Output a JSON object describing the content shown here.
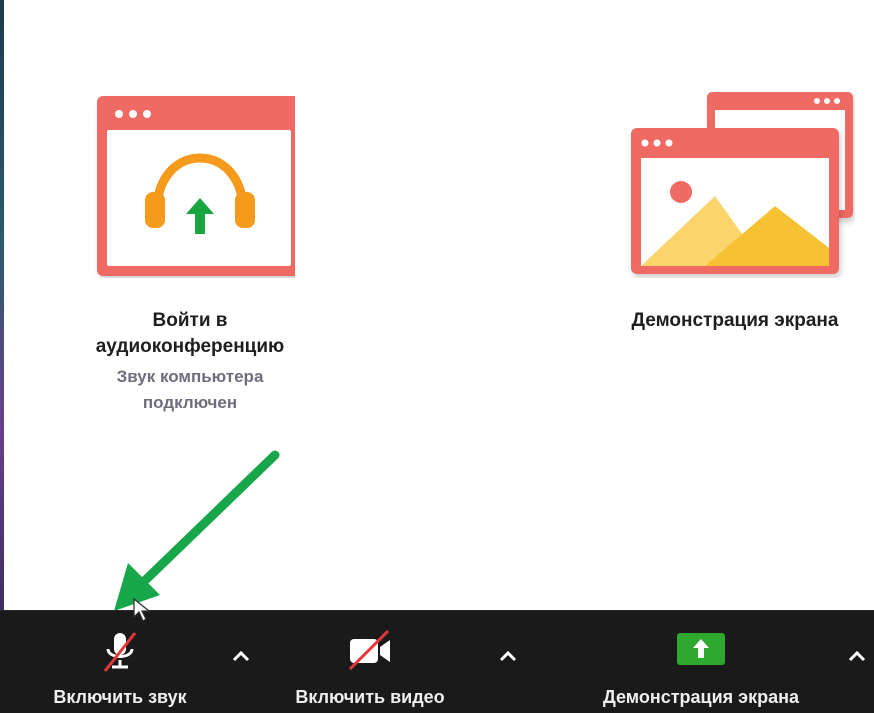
{
  "options": {
    "audio": {
      "icon": "headphones-icon",
      "title_line1": "Войти в",
      "title_line2": "аудиоконференцию",
      "sub_line1": "Звук компьютера",
      "sub_line2": "подключен"
    },
    "share": {
      "icon": "screen-share-icon",
      "title": "Демонстрация экрана"
    }
  },
  "toolbar": {
    "unmute": {
      "label": "Включить звук",
      "icon": "microphone-muted-icon"
    },
    "video": {
      "label": "Включить видео",
      "icon": "video-off-icon"
    },
    "share": {
      "label": "Демонстрация экрана",
      "icon": "share-screen-up-arrow-icon",
      "accent": "#2ea82e"
    }
  },
  "colors": {
    "window_red": "#ee6b62",
    "headset_orange": "#f59a1b",
    "arrow_green": "#1aa541",
    "annotation_green": "#18a64a",
    "toolbar_bg": "#1a1a1a"
  }
}
